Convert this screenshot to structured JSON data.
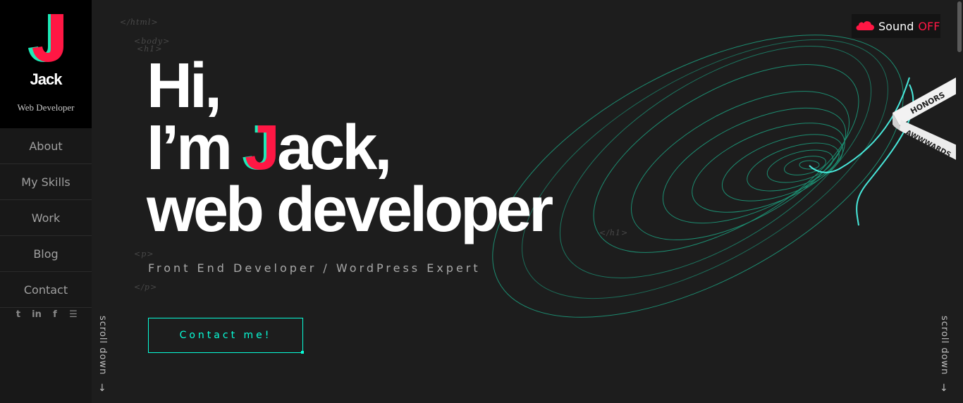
{
  "brand": {
    "name": "Jack",
    "subtitle": "Web Developer"
  },
  "nav": [
    {
      "label": "About"
    },
    {
      "label": "My Skills"
    },
    {
      "label": "Work"
    },
    {
      "label": "Blog"
    },
    {
      "label": "Contact"
    }
  ],
  "social": [
    {
      "icon": "twitter-icon",
      "glyph": "t"
    },
    {
      "icon": "linkedin-icon",
      "glyph": "in"
    },
    {
      "icon": "facebook-icon",
      "glyph": "f"
    },
    {
      "icon": "rss-icon",
      "glyph": "☰"
    }
  ],
  "code_tags": {
    "html_close": "</html>",
    "body_open": "<body>",
    "h1_open": "<h1>",
    "h1_close": "</h1>",
    "p_open": "<p>",
    "p_close": "</p>"
  },
  "hero": {
    "line1": "Hi,",
    "line2_before": "I’m ",
    "line2_letter": "J",
    "line2_after": "ack,",
    "line3": "web developer"
  },
  "subtitle": "Front End Developer / WordPress Expert",
  "contact_button": "Contact me!",
  "sound": {
    "label": "Sound",
    "state": "OFF"
  },
  "scroll_label": "scroll down",
  "scroll_arrow": "↓",
  "badge": {
    "top": "HONORS",
    "bottom": "AWWWARDS"
  },
  "colors": {
    "accent": "#08fdd8",
    "brand_red": "#ff1744",
    "brand_teal": "#1de9b6",
    "background": "#1d1d1d"
  }
}
